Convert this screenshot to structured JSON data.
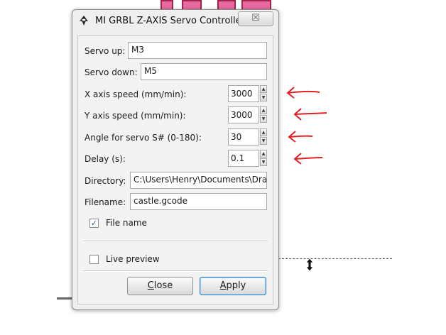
{
  "dialog": {
    "title": "MI GRBL Z-AXIS Servo Controller",
    "close_symbol": "☒"
  },
  "fields": {
    "servo_up": {
      "label": "Servo up:",
      "value": "M3"
    },
    "servo_down": {
      "label": "Servo down:",
      "value": "M5"
    },
    "x_speed": {
      "label": "X axis speed (mm/min):",
      "value": "3000"
    },
    "y_speed": {
      "label": "Y axis speed (mm/min):",
      "value": "3000"
    },
    "angle": {
      "label": "Angle for servo S# (0-180):",
      "value": "30"
    },
    "delay": {
      "label": "Delay (s):",
      "value": "0.1"
    },
    "directory": {
      "label": "Directory:",
      "value": "C:\\Users\\Henry\\Documents\\Dra"
    },
    "filename": {
      "label": "Filename:",
      "value": "castle.gcode"
    }
  },
  "checkboxes": {
    "file_name": {
      "label": "File name",
      "checked": true,
      "mark": "✓"
    },
    "live_preview": {
      "label": "Live preview",
      "checked": false,
      "mark": ""
    }
  },
  "buttons": {
    "close": "Close",
    "apply": "Apply"
  },
  "spin_symbols": {
    "up": "▲",
    "down": "▼"
  },
  "colors": {
    "annotation_red": "#e02020",
    "background_shape": "#e86aa0"
  },
  "icons": [
    "inkscape-icon",
    "close-icon",
    "red-arrow-icon",
    "resize-cursor-icon"
  ]
}
